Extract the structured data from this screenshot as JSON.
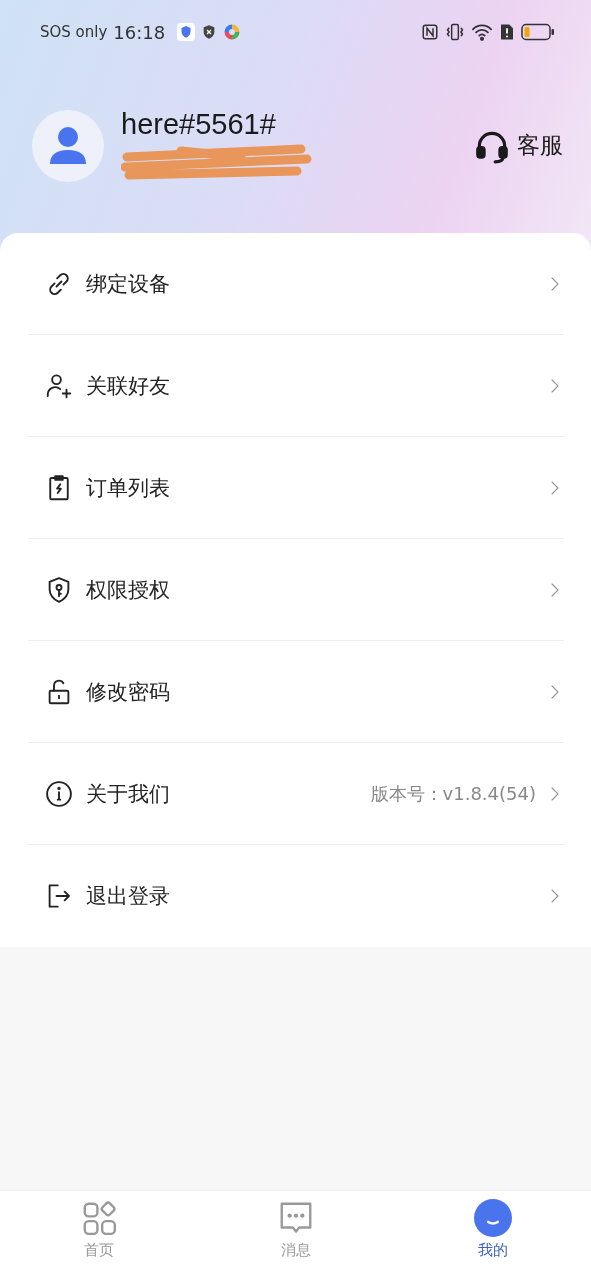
{
  "status_bar": {
    "carrier": "SOS only",
    "time": "16:18"
  },
  "profile": {
    "username": "here#5561#",
    "support": "客服"
  },
  "menu": [
    {
      "label": "绑定设备"
    },
    {
      "label": "关联好友"
    },
    {
      "label": "订单列表"
    },
    {
      "label": "权限授权"
    },
    {
      "label": "修改密码"
    },
    {
      "label": "关于我们",
      "value": "版本号：v1.8.4(54)"
    },
    {
      "label": "退出登录"
    }
  ],
  "tab_bar": [
    {
      "label": "首页",
      "selected": false
    },
    {
      "label": "消息",
      "selected": false
    },
    {
      "label": "我的",
      "selected": true
    }
  ]
}
